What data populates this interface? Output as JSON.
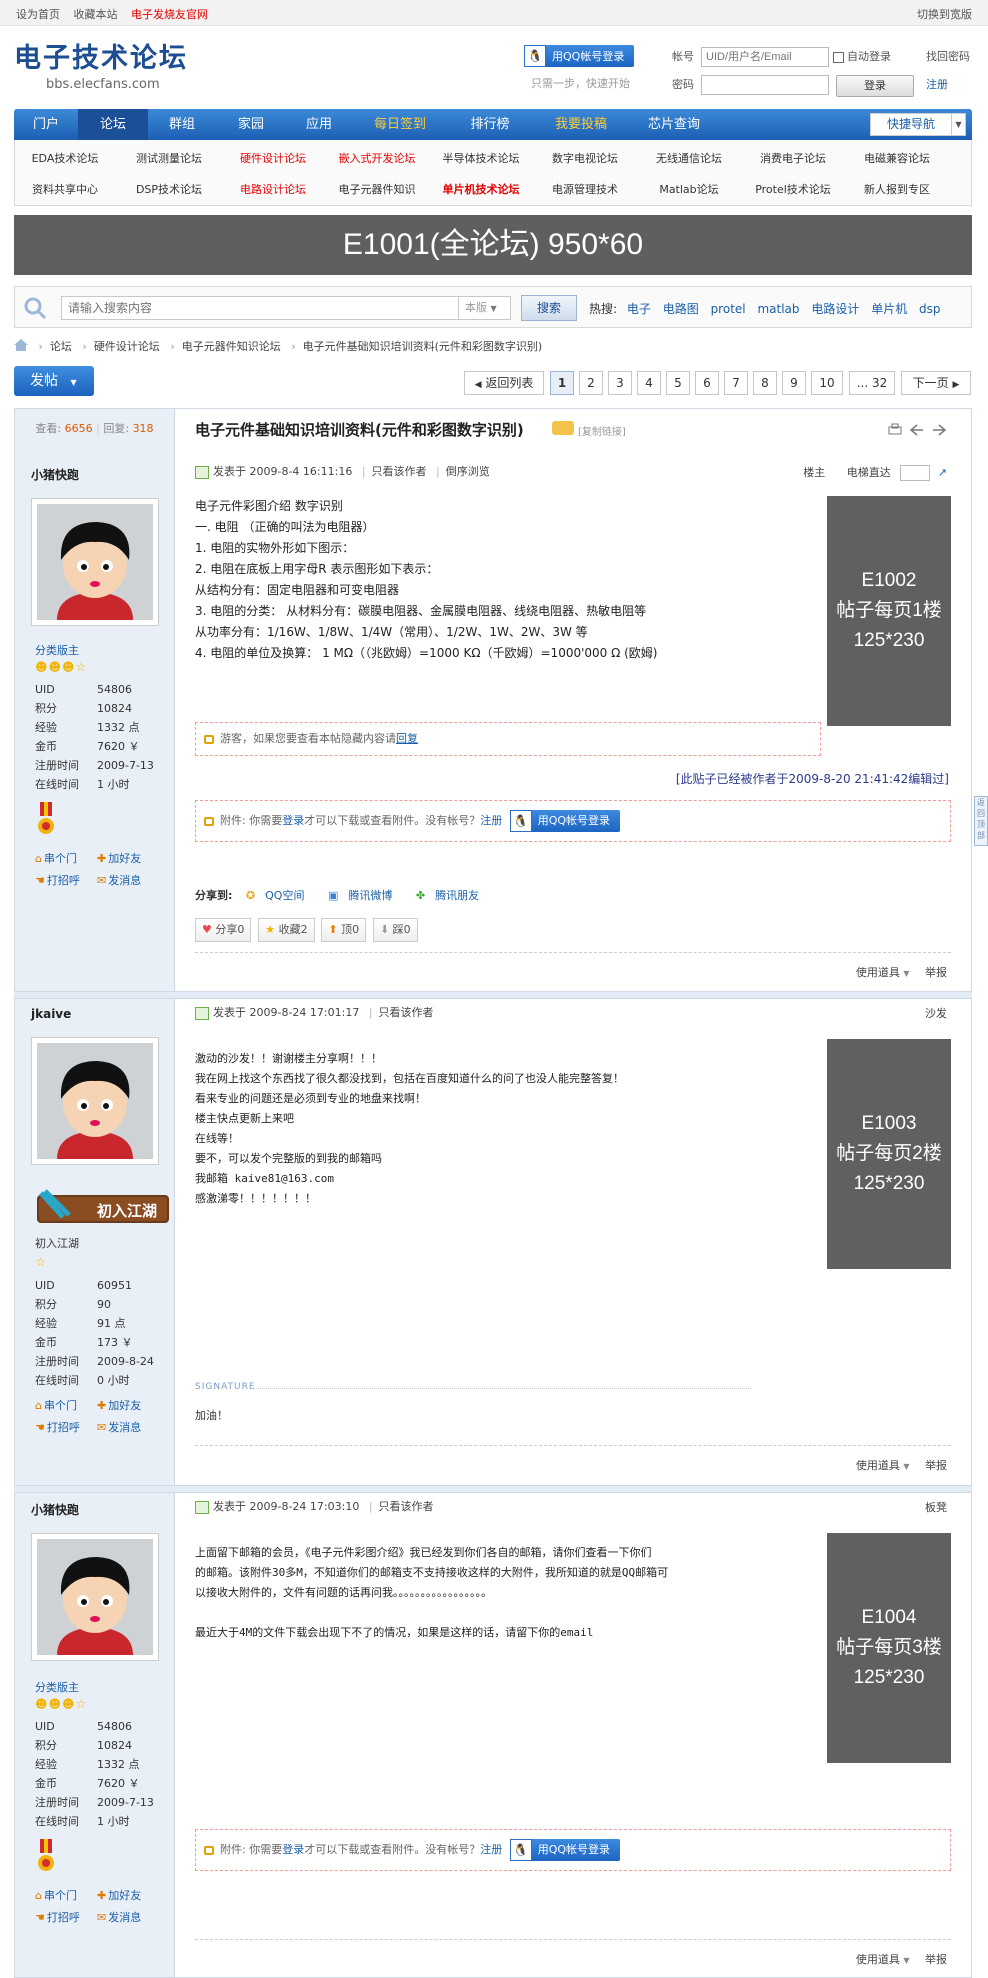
{
  "topbar": {
    "left": [
      "设为首页",
      "收藏本站"
    ],
    "left_red": "电子发烧友官网",
    "right": "切换到宽版"
  },
  "header": {
    "logo_title": "电子技术论坛",
    "logo_url": "bbs.elecfans.com",
    "qq_login": "用QQ帐号登录",
    "qq_sub": "只需一步，快速开始",
    "login": {
      "account_label": "帐号",
      "account_placeholder": "UID/用户名/Email",
      "auto_login": "自动登录",
      "find_password": "找回密码",
      "password_label": "密码",
      "login_button": "登录",
      "register": "注册"
    }
  },
  "nav": {
    "items": [
      "门户",
      "论坛",
      "群组",
      "家园",
      "应用",
      "每日签到",
      "排行榜",
      "我要投稿",
      "芯片查询"
    ],
    "quick_nav": "快捷导航"
  },
  "subnav": {
    "row1": [
      "EDA技术论坛",
      "测试测量论坛",
      "硬件设计论坛",
      "嵌入式开发论坛",
      "半导体技术论坛",
      "数字电视论坛",
      "无线通信论坛",
      "消费电子论坛",
      "电磁兼容论坛"
    ],
    "row2": [
      "资料共享中心",
      "DSP技术论坛",
      "电路设计论坛",
      "电子元器件知识",
      "单片机技术论坛",
      "电源管理技术",
      "Matlab论坛",
      "Protel技术论坛",
      "新人报到专区"
    ]
  },
  "banner": {
    "text": "E1001(全论坛) 950*60"
  },
  "search": {
    "placeholder": "请输入搜索内容",
    "scope": "本版",
    "button": "搜索",
    "hot_label": "热搜:",
    "hot": [
      "电子",
      "电路图",
      "protel",
      "matlab",
      "电路设计",
      "单片机",
      "dsp"
    ]
  },
  "breadcrumb": [
    "论坛",
    "硬件设计论坛",
    "电子元器件知识论坛",
    "电子元件基础知识培训资料(元件和彩图数字识别)"
  ],
  "post_button": "发帖",
  "pager": {
    "back": "返回列表",
    "pages": [
      "1",
      "2",
      "3",
      "4",
      "5",
      "6",
      "7",
      "8",
      "9",
      "10",
      "... 32"
    ],
    "current": "1",
    "next": "下一页"
  },
  "thread": {
    "views_label": "查看:",
    "views": "6656",
    "replies_label": "回复:",
    "replies": "318",
    "title": "电子元件基础知识培训资料(元件和彩图数字识别)",
    "copy_link": "[复制链接]"
  },
  "posts": [
    {
      "author": "小猪快跑",
      "group": "分类版主",
      "stats": [
        [
          "UID",
          "54806"
        ],
        [
          "积分",
          "10824"
        ],
        [
          "经验",
          "1332 点"
        ],
        [
          "金币",
          "7620 ￥"
        ],
        [
          "注册时间",
          "2009-7-13"
        ],
        [
          "在线时间",
          "1 小时"
        ]
      ],
      "actions": [
        [
          "串个门",
          "加好友"
        ],
        [
          "打招呼",
          "发消息"
        ]
      ],
      "meta": {
        "time": "发表于 2009-8-4 16:11:16",
        "only": "只看该作者",
        "order": "倒序浏览"
      },
      "floor": "楼主",
      "jump": "电梯直达",
      "content": [
        "电子元件彩图介绍 数字识别",
        "一. 电阻 （正确的叫法为电阻器）",
        "1. 电阻的实物外形如下图示：",
        "2. 电阻在底板上用字母R 表示图形如下表示：",
        "从结构分有：固定电阻器和可变电阻器",
        "3. 电阻的分类： 从材料分有：碳膜电阻器、金属膜电阻器、线绕电阻器、热敏电阻等",
        "从功率分有：1/16W、1/8W、1/4W（常用）、1/2W、1W、2W、3W 等",
        "4. 电阻的单位及换算： 1 MΩ（（兆欧姆）=1000 KΩ（千欧姆）=1000'000 Ω (欧姆)"
      ],
      "ad": [
        "E1002",
        "帖子每页1楼",
        "125*230"
      ],
      "hidden_note": "游客，如果您要查看本帖隐藏内容请",
      "hidden_link": "回复",
      "edit_note": "[此贴子已经被作者于2009-8-20 21:41:42编辑过]",
      "attach": {
        "text": "附件: 你需要",
        "login": "登录",
        "text2": "才可以下载或查看附件。没有帐号？",
        "reg": "注册",
        "qq": "用QQ帐号登录"
      },
      "share_label": "分享到:",
      "share": [
        "QQ空间",
        "腾讯微博",
        "腾讯朋友"
      ],
      "buttons": [
        "分享0",
        "收藏2",
        "顶0",
        "踩0"
      ],
      "footer": [
        "使用道具",
        "举报"
      ]
    },
    {
      "author": "jkaive",
      "badge": "初入江湖",
      "group": "初入江湖",
      "stats": [
        [
          "UID",
          "60951"
        ],
        [
          "积分",
          "90"
        ],
        [
          "经验",
          "91 点"
        ],
        [
          "金币",
          "173 ￥"
        ],
        [
          "注册时间",
          "2009-8-24"
        ],
        [
          "在线时间",
          "0 小时"
        ]
      ],
      "actions": [
        [
          "串个门",
          "加好友"
        ],
        [
          "打招呼",
          "发消息"
        ]
      ],
      "meta": {
        "time": "发表于 2009-8-24 17:01:17",
        "only": "只看该作者"
      },
      "floor": "沙发",
      "content": [
        "激动的沙发！！谢谢楼主分享啊！！！",
        "我在网上找这个东西找了很久都没找到，包括在百度知道什么的问了也没人能完整答复！",
        "看来专业的问题还是必须到专业的地盘来找啊！",
        "楼主快点更新上来吧",
        "在线等！",
        "要不，可以发个完整版的到我的邮箱吗",
        "我邮箱 kaive81@163.com",
        "感激涕零！！！！！！！"
      ],
      "ad": [
        "E1003",
        "帖子每页2楼",
        "125*230"
      ],
      "signature_label": "SIGNATURE",
      "signature": "加油！",
      "footer": [
        "使用道具",
        "举报"
      ]
    },
    {
      "author": "小猪快跑",
      "group": "分类版主",
      "stats": [
        [
          "UID",
          "54806"
        ],
        [
          "积分",
          "10824"
        ],
        [
          "经验",
          "1332 点"
        ],
        [
          "金币",
          "7620 ￥"
        ],
        [
          "注册时间",
          "2009-7-13"
        ],
        [
          "在线时间",
          "1 小时"
        ]
      ],
      "actions": [
        [
          "串个门",
          "加好友"
        ],
        [
          "打招呼",
          "发消息"
        ]
      ],
      "meta": {
        "time": "发表于 2009-8-24 17:03:10",
        "only": "只看该作者"
      },
      "floor": "板凳",
      "content": [
        "上面留下邮箱的会员，《电子元件彩图介绍》我已经发到你们各自的邮箱，请你们查看一下你们",
        "的邮箱。该附件30多M，不知道你们的邮箱支不支持接收这样的大附件，我所知道的就是QQ邮箱可",
        "以接收大附件的，文件有问题的话再问我。。。。。。。。。。。。。。。。。",
        "",
        "最近大于4M的文件下载会出现下不了的情况，如果是这样的话，请留下你的email"
      ],
      "ad": [
        "E1004",
        "帖子每页3楼",
        "125*230"
      ],
      "attach": {
        "text": "附件: 你需要",
        "login": "登录",
        "text2": "才可以下载或查看附件。没有帐号？",
        "reg": "注册",
        "qq": "用QQ帐号登录"
      },
      "footer": [
        "使用道具",
        "举报"
      ]
    }
  ],
  "side_tab": "返回顶部"
}
